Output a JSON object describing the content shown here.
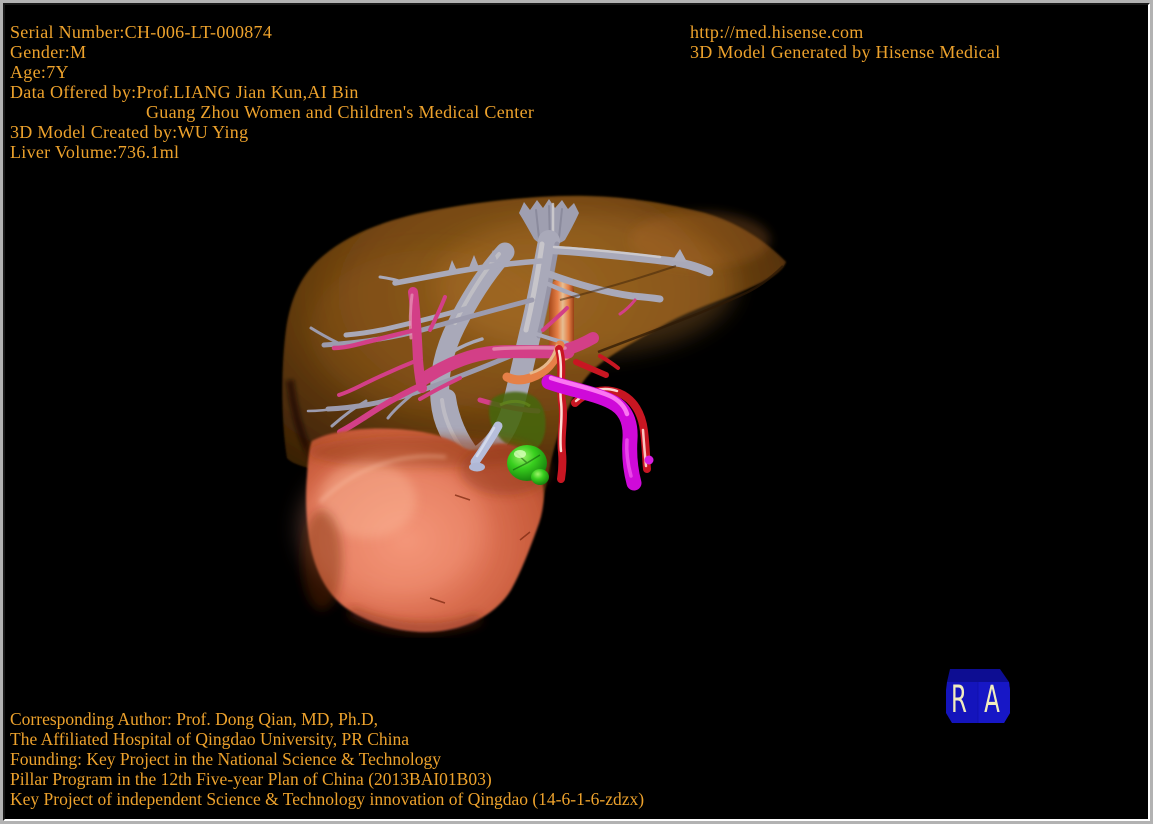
{
  "viewport": {
    "background_color": "#000000",
    "frame_color": "#B2B2B2"
  },
  "overlay": {
    "text_color": "#EDA22C",
    "top_left": {
      "serial_number": "Serial Number:CH-006-LT-000874",
      "gender": "Gender:M",
      "age": "Age:7Y",
      "data_offered_by": "Data Offered by:Prof.LIANG Jian Kun,AI Bin",
      "data_offered_by_org": "Guang Zhou Women and Children's Medical Center",
      "model_created_by": "3D Model Created by:WU Ying",
      "liver_volume": "Liver Volume:736.1ml"
    },
    "top_right": {
      "website": "http://med.hisense.com",
      "generated_by": "3D Model Generated by Hisense Medical"
    },
    "bottom_left": {
      "corresponding_author": "Corresponding Author: Prof. Dong Qian, MD, Ph.D,",
      "affiliation": "The Affiliated Hospital of Qingdao University, PR China",
      "funding_line1": "Founding: Key Project in the National Science & Technology",
      "funding_line2": "Pillar Program in the 12th Five-year Plan of China (2013BAI01B03)",
      "funding_line3": "Key Project of independent Science & Technology innovation of Qingdao (14-6-1-6-zdzx)"
    }
  },
  "orientation_cube": {
    "left_face_label": "R",
    "right_face_label": "A",
    "face_color": "#1414BC",
    "top_face_color": "#0D0D92",
    "letter_color": "#F2EDBE"
  },
  "model_3d": {
    "colors": {
      "liver": "#7A4A14",
      "tumor": "#D4663F",
      "hepatic_veins": "#B6BEDB",
      "portal_vein_branches": "#E83F9F",
      "main_portal_vein": "#CF0AD9",
      "hepatic_artery": "#C81622",
      "gallbladder": "#2FCE1F",
      "inferior_vena_cava": "#FF8D52"
    }
  }
}
